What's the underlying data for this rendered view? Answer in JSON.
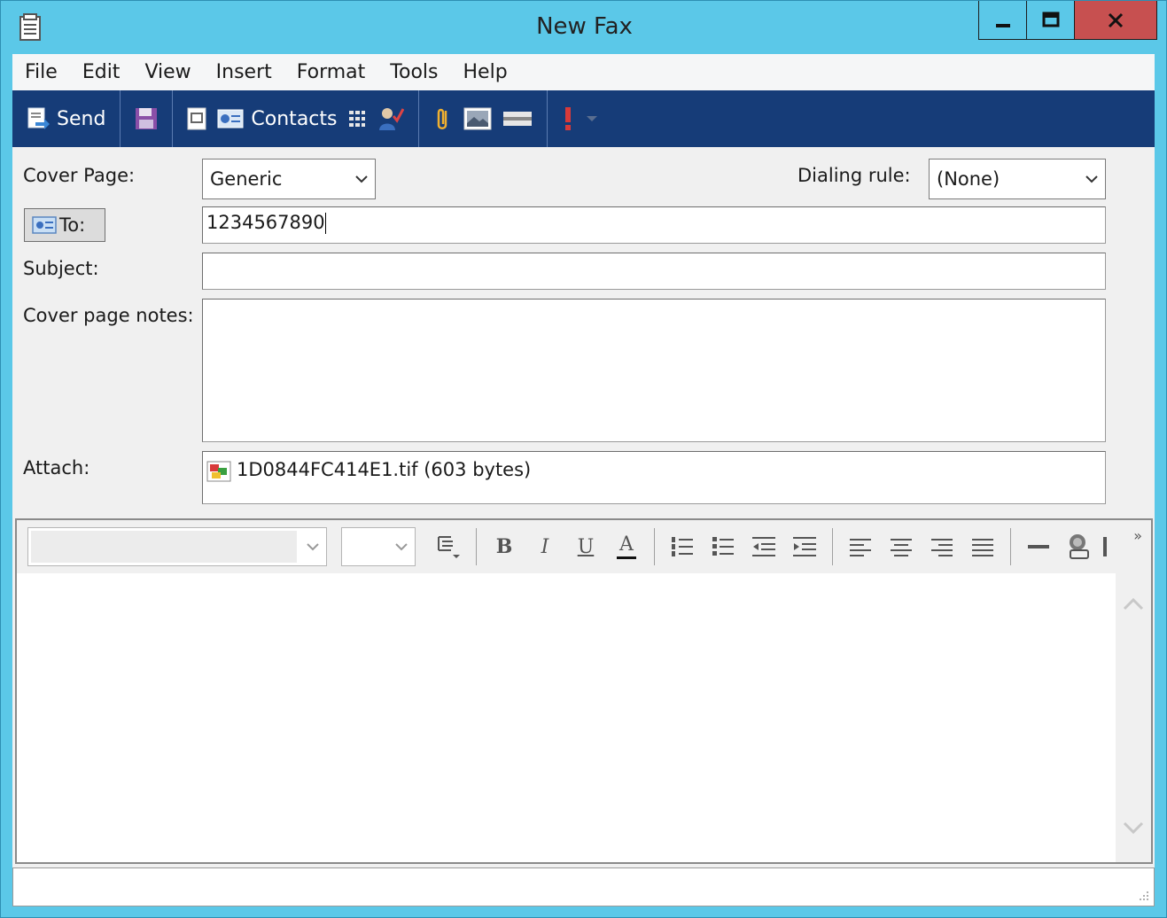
{
  "window": {
    "title": "New Fax",
    "icons": {
      "app": "fax-document-icon",
      "minimize": "minimize-icon",
      "maximize": "maximize-icon",
      "close": "close-icon"
    },
    "close_color": "#c75050",
    "frame_color": "#5bc8e8"
  },
  "menu": {
    "items": [
      "File",
      "Edit",
      "View",
      "Insert",
      "Format",
      "Tools",
      "Help"
    ]
  },
  "toolbar": {
    "background": "#163c78",
    "send_label": "Send",
    "contacts_label": "Contacts",
    "icons": [
      "send-icon",
      "save-icon",
      "cover-page-icon",
      "contacts-icon",
      "grid-icon",
      "check-names-icon",
      "paperclip-icon",
      "insert-picture-icon",
      "scan-icon",
      "priority-icon",
      "dropdown-arrow-icon"
    ]
  },
  "form": {
    "cover_page_label": "Cover Page:",
    "cover_page_value": "Generic",
    "dialing_rule_label": "Dialing rule:",
    "dialing_rule_value": "(None)",
    "to_button_label": "To:",
    "to_value": "1234567890",
    "subject_label": "Subject:",
    "subject_value": "",
    "notes_label": "Cover page notes:",
    "notes_value": "",
    "attach_label": "Attach:",
    "attachment": "1D0844FC414E1.tif (603 bytes)"
  },
  "editor": {
    "font_name": "",
    "font_size": "",
    "format_icons": [
      "paragraph-style-icon",
      "bold-icon",
      "italic-icon",
      "underline-icon",
      "font-color-icon",
      "numbered-list-icon",
      "bulleted-list-icon",
      "decrease-indent-icon",
      "increase-indent-icon",
      "align-left-icon",
      "align-center-icon",
      "align-right-icon",
      "justify-icon",
      "horizontal-line-icon",
      "insert-link-icon",
      "more-icon"
    ],
    "bold_glyph": "B",
    "italic_glyph": "I",
    "underline_glyph": "U",
    "font_color_glyph": "A",
    "overflow_glyph": "»",
    "body": ""
  },
  "statusbar": {
    "text": ""
  }
}
